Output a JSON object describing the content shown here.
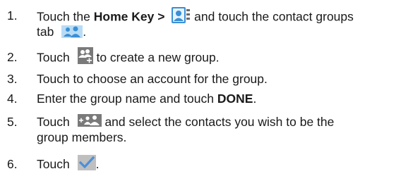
{
  "steps": [
    {
      "number": "1.",
      "t1": "Touch the ",
      "bold1": "Home Key >",
      "t2": " and touch the contact groups",
      "t3": "tab",
      "t4": "."
    },
    {
      "number": "2.",
      "t1": "Touch",
      "t2": " to create a new group."
    },
    {
      "number": "3.",
      "text": "Touch to choose an account for the group."
    },
    {
      "number": "4.",
      "t1": "Enter the group name and touch ",
      "bold": "DONE",
      "t2": "."
    },
    {
      "number": "5.",
      "t1": "Touch",
      "t2": " and select the contacts you wish to be the",
      "line2": "group members."
    },
    {
      "number": "6.",
      "t1": "Touch",
      "t2": "."
    }
  ],
  "icons": {
    "contacts_app": "contacts-app-icon",
    "contact_groups_tab": "contact-groups-tab-icon",
    "add_group": "add-group-icon",
    "add_members": "add-members-icon",
    "done_check": "checkmark-icon"
  },
  "colors": {
    "icon_blue": "#3a8fd6",
    "icon_gray": "#6b6b6b",
    "check_blue": "#4a90d9"
  }
}
